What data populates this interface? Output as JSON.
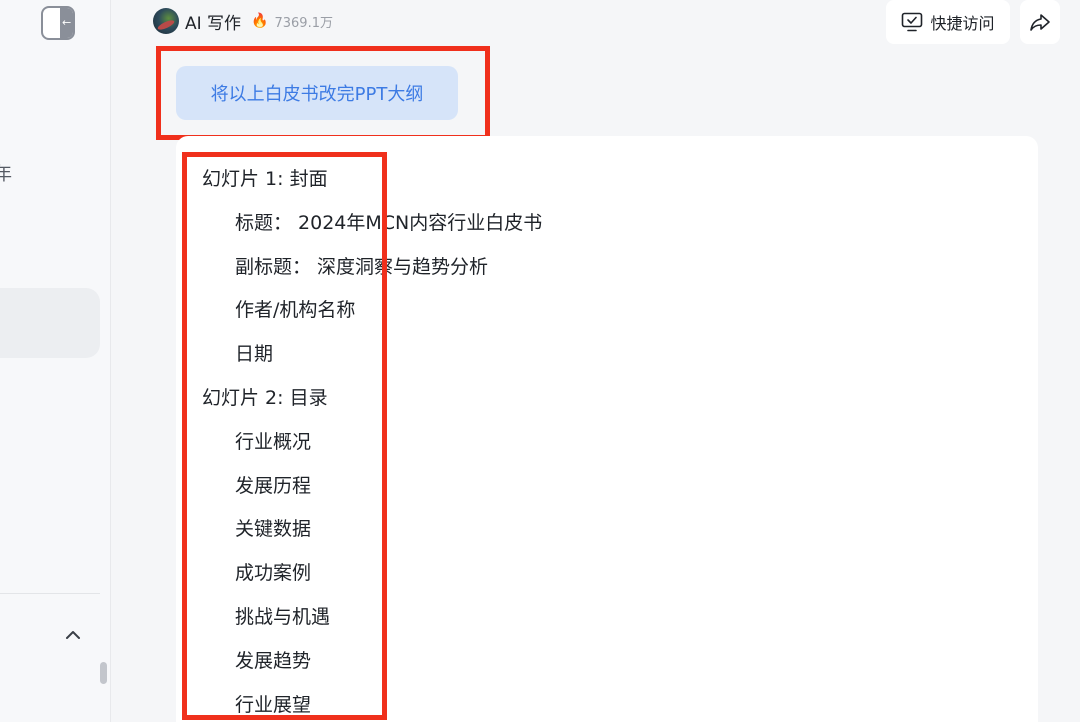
{
  "app": {
    "title": "AI 写作",
    "hot_count": "7369.1万"
  },
  "header": {
    "quick_access_label": "快捷访问"
  },
  "sidebar": {
    "clipped_label": "年"
  },
  "prompt": {
    "text": "将以上白皮书改完PPT大纲"
  },
  "outline": [
    {
      "level": 1,
      "text": "幻灯片 1: 封面"
    },
    {
      "level": 2,
      "text": "标题： 2024年MCN内容行业白皮书"
    },
    {
      "level": 2,
      "text": "副标题： 深度洞察与趋势分析"
    },
    {
      "level": 2,
      "text": "作者/机构名称"
    },
    {
      "level": 2,
      "text": "日期"
    },
    {
      "level": 1,
      "text": "幻灯片 2: 目录"
    },
    {
      "level": 2,
      "text": "行业概况"
    },
    {
      "level": 2,
      "text": "发展历程"
    },
    {
      "level": 2,
      "text": "关键数据"
    },
    {
      "level": 2,
      "text": "成功案例"
    },
    {
      "level": 2,
      "text": "挑战与机遇"
    },
    {
      "level": 2,
      "text": "发展趋势"
    },
    {
      "level": 2,
      "text": "行业展望"
    }
  ],
  "colors": {
    "highlight": "#f0301c",
    "prompt_bg": "#d6e4f9",
    "prompt_text": "#3d7be4"
  }
}
